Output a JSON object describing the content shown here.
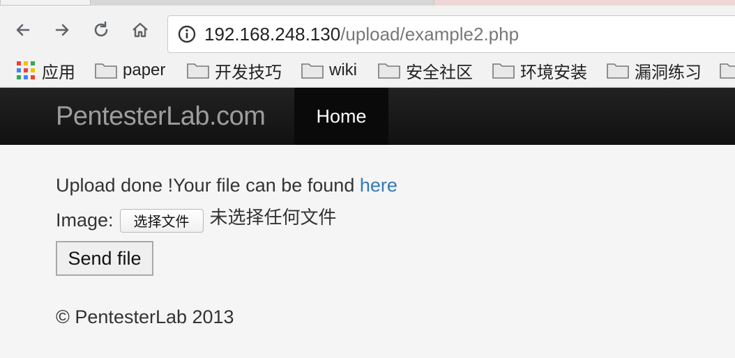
{
  "browser": {
    "url_host": "192.168.248.130",
    "url_path": "/upload/example2.php",
    "icons": {
      "back": "arrow-left-icon",
      "forward": "arrow-right-icon",
      "reload": "reload-icon",
      "home": "home-icon",
      "info": "info-icon"
    },
    "bookmarks": [
      {
        "label": "应用",
        "icon": "apps-grid-icon"
      },
      {
        "label": "paper",
        "icon": "folder-icon"
      },
      {
        "label": "开发技巧",
        "icon": "folder-icon"
      },
      {
        "label": "wiki",
        "icon": "folder-icon"
      },
      {
        "label": "安全社区",
        "icon": "folder-icon"
      },
      {
        "label": "环境安装",
        "icon": "folder-icon"
      },
      {
        "label": "漏洞练习",
        "icon": "folder-icon"
      }
    ]
  },
  "site": {
    "brand": "PentesterLab.com",
    "nav_home": "Home",
    "message_prefix": "Upload done !Your file can be found ",
    "message_link": "here",
    "image_label": "Image:",
    "file_button": "选择文件",
    "no_file_text": "未选择任何文件",
    "send_button": "Send file",
    "footer": "© PentesterLab 2013",
    "colors": {
      "navbar": "#1b1b1b",
      "link": "#337ab7",
      "brand": "#9d9d9d"
    }
  }
}
